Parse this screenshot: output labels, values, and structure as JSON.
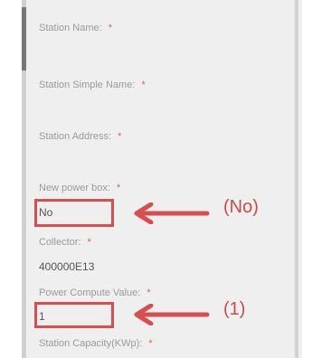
{
  "form": {
    "station_name_label": "Station Name:",
    "station_simple_name_label": "Station Simple Name:",
    "station_address_label": "Station Address:",
    "new_power_box_label": "New power box:",
    "new_power_box_value": "No",
    "collector_label": "Collector:",
    "collector_value": "400000E13",
    "power_compute_value_label": "Power Compute Value:",
    "power_compute_value_value": "1",
    "station_capacity_label": "Station Capacity(KWp):",
    "required_mark": "*"
  },
  "annotations": {
    "no_label": "(No)",
    "one_label": "(1)"
  },
  "colors": {
    "highlight": "#d84d4d",
    "annotation": "#cc4b4b"
  }
}
